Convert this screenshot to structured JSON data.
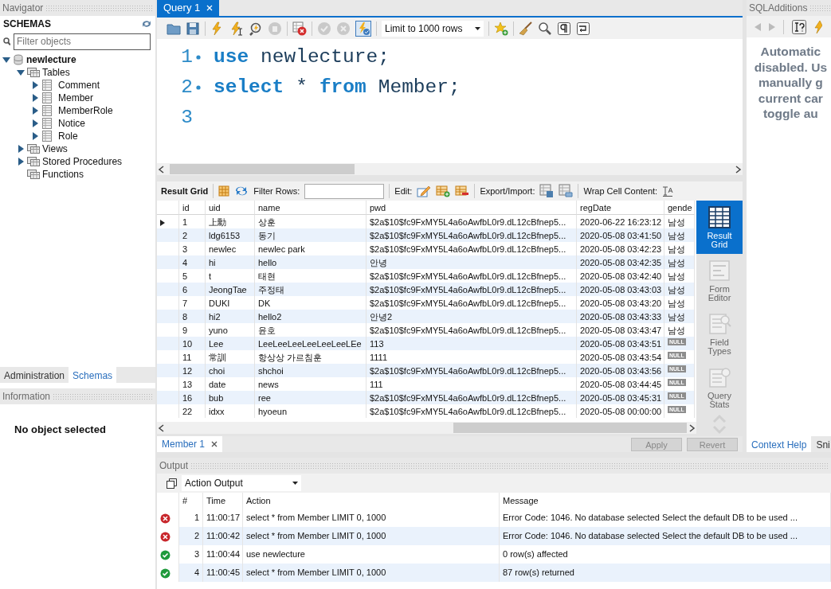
{
  "navigator": {
    "title": "Navigator",
    "heading": "SCHEMAS",
    "filter_placeholder": "Filter objects",
    "tree": [
      {
        "label": "newlecture",
        "kind": "schema",
        "expandable": true,
        "expanded": true,
        "children": [
          {
            "label": "Tables",
            "kind": "folder",
            "expandable": true,
            "expanded": true,
            "children": [
              {
                "label": "Comment",
                "kind": "table",
                "expandable": true,
                "expanded": false
              },
              {
                "label": "Member",
                "kind": "table",
                "expandable": true,
                "expanded": false
              },
              {
                "label": "MemberRole",
                "kind": "table",
                "expandable": true,
                "expanded": false
              },
              {
                "label": "Notice",
                "kind": "table",
                "expandable": true,
                "expanded": false
              },
              {
                "label": "Role",
                "kind": "table",
                "expandable": true,
                "expanded": false
              }
            ]
          },
          {
            "label": "Views",
            "kind": "folder",
            "expandable": true,
            "expanded": false
          },
          {
            "label": "Stored Procedures",
            "kind": "folder",
            "expandable": true,
            "expanded": false
          },
          {
            "label": "Functions",
            "kind": "folder",
            "expandable": false
          }
        ]
      }
    ],
    "bottom_tabs": [
      {
        "label": "Administration",
        "selected": false
      },
      {
        "label": "Schemas",
        "selected": true
      }
    ],
    "information": {
      "title": "Information",
      "message": "No object selected"
    }
  },
  "query_tab": {
    "label": "Query 1",
    "selected": true
  },
  "limit_select": "Limit to 1000 rows",
  "editor": {
    "lines": [
      {
        "number": "1",
        "statement": true,
        "tokens": [
          {
            "kind": "keyword",
            "text": "use"
          },
          {
            "kind": "plain",
            "text": "newlecture;"
          }
        ]
      },
      {
        "number": "2",
        "statement": true,
        "tokens": [
          {
            "kind": "keyword",
            "text": "select"
          },
          {
            "kind": "plain",
            "text": "*"
          },
          {
            "kind": "keyword",
            "text": "from"
          },
          {
            "kind": "plain",
            "text": "Member;"
          }
        ]
      },
      {
        "number": "3",
        "statement": false
      }
    ]
  },
  "result_toolbar": {
    "title": "Result Grid",
    "filter_label": "Filter Rows:",
    "edit_label": "Edit:",
    "export_label": "Export/Import:",
    "wrap_label": "Wrap Cell Content:"
  },
  "grid": {
    "columns": [
      "id",
      "uid",
      "name",
      "pwd",
      "regDate",
      "gende"
    ],
    "rows": [
      {
        "selected": true,
        "id": "1",
        "uid": "上勳",
        "name": "상훈",
        "pwd": "$2a$10$fc9FxMY5L4a6oAwfbL0r9.dL12cBfnep5...",
        "regDate": "2020-06-22 16:23:12",
        "gender": "남성",
        "gender_null": false
      },
      {
        "selected": false,
        "id": "2",
        "uid": "ldg6153",
        "name": "동기",
        "pwd": "$2a$10$fc9FxMY5L4a6oAwfbL0r9.dL12cBfnep5...",
        "regDate": "2020-05-08 03:41:50",
        "gender": "남성",
        "gender_null": false
      },
      {
        "selected": false,
        "id": "3",
        "uid": "newlec",
        "name": "newlec park",
        "pwd": "$2a$10$fc9FxMY5L4a6oAwfbL0r9.dL12cBfnep5...",
        "regDate": "2020-05-08 03:42:23",
        "gender": "남성",
        "gender_null": false
      },
      {
        "selected": false,
        "id": "4",
        "uid": "hi",
        "name": "hello",
        "pwd": "안녕",
        "regDate": "2020-05-08 03:42:35",
        "gender": "남성",
        "gender_null": false
      },
      {
        "selected": false,
        "id": "5",
        "uid": "t",
        "name": "태현",
        "pwd": "$2a$10$fc9FxMY5L4a6oAwfbL0r9.dL12cBfnep5...",
        "regDate": "2020-05-08 03:42:40",
        "gender": "남성",
        "gender_null": false
      },
      {
        "selected": false,
        "id": "6",
        "uid": "JeongTae",
        "name": "주정태",
        "pwd": "$2a$10$fc9FxMY5L4a6oAwfbL0r9.dL12cBfnep5...",
        "regDate": "2020-05-08 03:43:03",
        "gender": "남성",
        "gender_null": false
      },
      {
        "selected": false,
        "id": "7",
        "uid": "DUKI",
        "name": "DK",
        "pwd": "$2a$10$fc9FxMY5L4a6oAwfbL0r9.dL12cBfnep5...",
        "regDate": "2020-05-08 03:43:20",
        "gender": "남성",
        "gender_null": false
      },
      {
        "selected": false,
        "id": "8",
        "uid": "hi2",
        "name": "hello2",
        "pwd": "안녕2",
        "regDate": "2020-05-08 03:43:33",
        "gender": "남성",
        "gender_null": false
      },
      {
        "selected": false,
        "id": "9",
        "uid": "yuno",
        "name": "윤호",
        "pwd": "$2a$10$fc9FxMY5L4a6oAwfbL0r9.dL12cBfnep5...",
        "regDate": "2020-05-08 03:43:47",
        "gender": "남성",
        "gender_null": false
      },
      {
        "selected": false,
        "id": "10",
        "uid": "Lee",
        "name": "LeeLeeLeeLeeLeeLeeLEe",
        "pwd": "113",
        "regDate": "2020-05-08 03:43:51",
        "gender": "NULL",
        "gender_null": true
      },
      {
        "selected": false,
        "id": "11",
        "uid": "常訓",
        "name": "항상상 가르침훈",
        "pwd": "1111",
        "regDate": "2020-05-08 03:43:54",
        "gender": "NULL",
        "gender_null": true
      },
      {
        "selected": false,
        "id": "12",
        "uid": "choi",
        "name": "shchoi",
        "pwd": "$2a$10$fc9FxMY5L4a6oAwfbL0r9.dL12cBfnep5...",
        "regDate": "2020-05-08 03:43:56",
        "gender": "NULL",
        "gender_null": true
      },
      {
        "selected": false,
        "id": "13",
        "uid": "date",
        "name": "news",
        "pwd": "111",
        "regDate": "2020-05-08 03:44:45",
        "gender": "NULL",
        "gender_null": true
      },
      {
        "selected": false,
        "id": "16",
        "uid": "bub",
        "name": "ree",
        "pwd": "$2a$10$fc9FxMY5L4a6oAwfbL0r9.dL12cBfnep5...",
        "regDate": "2020-05-08 03:45:31",
        "gender": "NULL",
        "gender_null": true
      },
      {
        "selected": false,
        "id": "22",
        "uid": "idxx",
        "name": "hyoeun",
        "pwd": "$2a$10$fc9FxMY5L4a6oAwfbL0r9.dL12cBfnep5...",
        "regDate": "2020-05-08 00:00:00",
        "gender": "NULL",
        "gender_null": true
      }
    ]
  },
  "side_panel": [
    {
      "label": "Result Grid",
      "kind": "grid",
      "selected": true
    },
    {
      "label": "Form Editor",
      "kind": "form",
      "selected": false
    },
    {
      "label": "Field Types",
      "kind": "fields",
      "selected": false
    },
    {
      "label": "Query Stats",
      "kind": "stats",
      "selected": false
    }
  ],
  "result_tab": {
    "label": "Member 1",
    "selected": true
  },
  "buttons": [
    {
      "label": "Apply",
      "disabled": true
    },
    {
      "label": "Revert",
      "disabled": true
    }
  ],
  "sql_additions": {
    "title": "SQLAdditions",
    "help_lines": [
      "Automatic",
      "disabled. Us",
      "manually g",
      "current car",
      "toggle au"
    ],
    "tabs": [
      {
        "label": "Context Help",
        "selected": true
      },
      {
        "label": "Sni",
        "selected": false
      }
    ]
  },
  "output": {
    "title": "Output",
    "selector": "Action Output",
    "columns": [
      "#",
      "Time",
      "Action",
      "Message"
    ],
    "rows": [
      {
        "kind": "error",
        "number": "1",
        "time": "11:00:17",
        "action": "select * from Member LIMIT 0, 1000",
        "message": "Error Code: 1046. No database selected Select the default DB to be used ..."
      },
      {
        "kind": "error",
        "number": "2",
        "time": "11:00:42",
        "action": "select * from Member LIMIT 0, 1000",
        "message": "Error Code: 1046. No database selected Select the default DB to be used ..."
      },
      {
        "kind": "ok",
        "number": "3",
        "time": "11:00:44",
        "action": "use newlecture",
        "message": "0 row(s) affected"
      },
      {
        "kind": "ok",
        "number": "4",
        "time": "11:00:45",
        "action": "select * from Member LIMIT 0, 1000",
        "message": "87 row(s) returned"
      }
    ]
  }
}
